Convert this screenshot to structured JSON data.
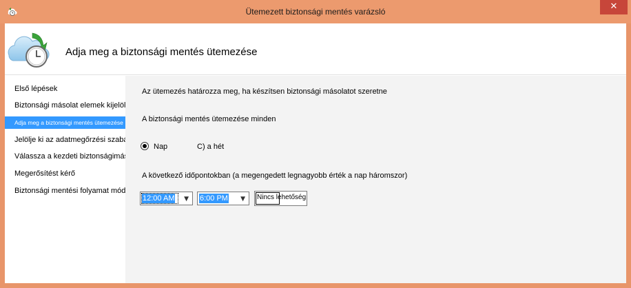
{
  "window": {
    "title": "Ütemezett biztonsági mentés varázsló",
    "close_label": "✕",
    "accent_color": "#ec9a6e",
    "close_color": "#c7463a"
  },
  "header": {
    "title": "Adja meg a biztonsági mentés ütemezése",
    "icon": "cloud-backup-clock-icon"
  },
  "nav": {
    "items": [
      {
        "label": "Első lépések"
      },
      {
        "label": "Biztonsági másolat elemek kijelölése"
      },
      {
        "label": "Adja meg a biztonsági mentés ütemezése"
      },
      {
        "label": "Jelölje ki az adatmegőrzési szabály"
      },
      {
        "label": "Válassza a kezdeti biztonságimásolat-típus"
      },
      {
        "label": "Megerősítést kérő"
      },
      {
        "label": "Biztonsági mentési folyamat módosítása"
      }
    ],
    "selected_index": 2,
    "selected_color": "#3399ff"
  },
  "content": {
    "description": "Az ütemezés határozza meg, ha készítsen biztonsági másolatot szeretne",
    "frequency_label": "A biztonsági mentés ütemezése minden",
    "radio_day": "Nap",
    "radio_week": "C) a hét",
    "times_label": "A következő időpontokban (a megengedett legnagyobb érték a nap háromszor)",
    "time1": "12:00 AM",
    "time2": "6:00 PM",
    "time3": "Nincs lehetőség"
  }
}
